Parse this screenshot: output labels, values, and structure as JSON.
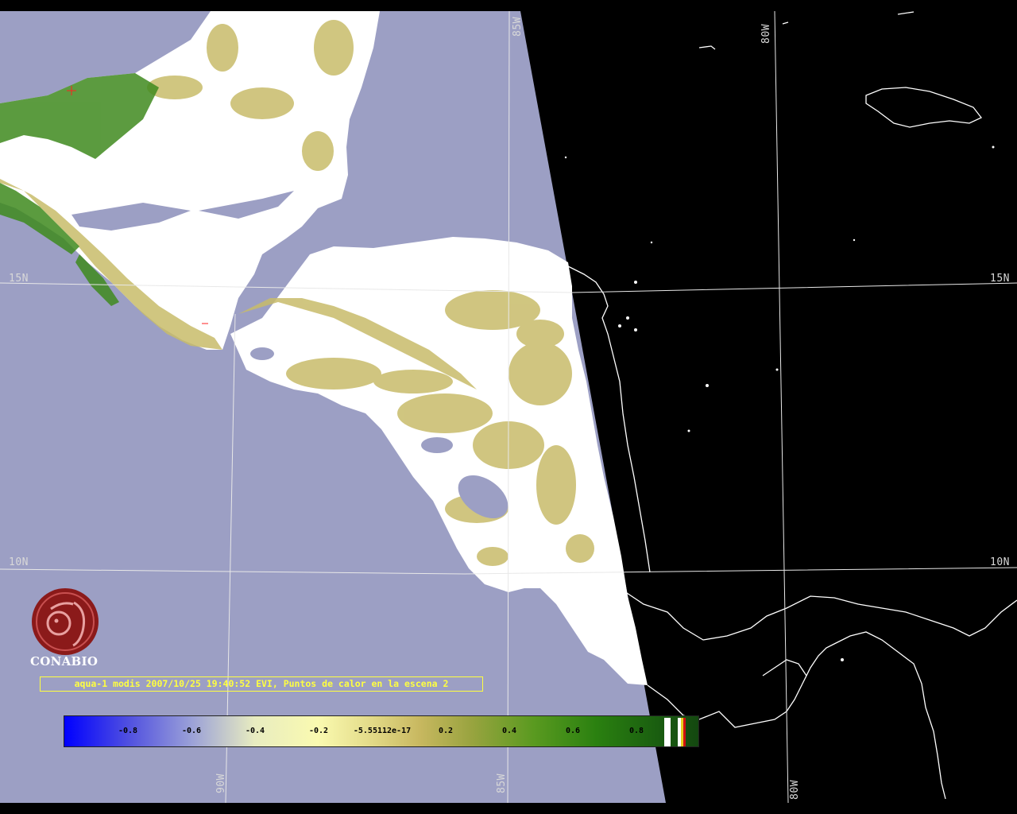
{
  "map": {
    "grid_labels": {
      "lat_15_left": "15N",
      "lat_15_right": "15N",
      "lat_10_left": "10N",
      "lat_10_right": "10N",
      "lon_85_top": "85W",
      "lon_80_top": "80W",
      "lon_90_bottom": "90W",
      "lon_85_bottom": "85W",
      "lon_80_bottom": "80W"
    },
    "colors": {
      "ocean": "#9c9fc4",
      "land_cloud": "#ffffff",
      "vegetation_low": "#c8bc6a",
      "vegetation_high": "#3f8a1e",
      "night_side": "#000000",
      "coastline_night": "#ffffff",
      "gridline": "#e8e8e8"
    }
  },
  "logo": {
    "text": "CONABIO",
    "color": "#8b1a1a"
  },
  "caption": {
    "text": "aqua-1 modis 2007/10/25 19:40:52 EVI, Puntos de calor en la escena 2",
    "color": "#ffff40"
  },
  "colorbar": {
    "ticks": [
      "-0.8",
      "-0.6",
      "-0.4",
      "-0.2",
      "-5.55112e-17",
      "0.2",
      "0.4",
      "0.6",
      "0.8"
    ],
    "range": [
      -1,
      1
    ]
  }
}
